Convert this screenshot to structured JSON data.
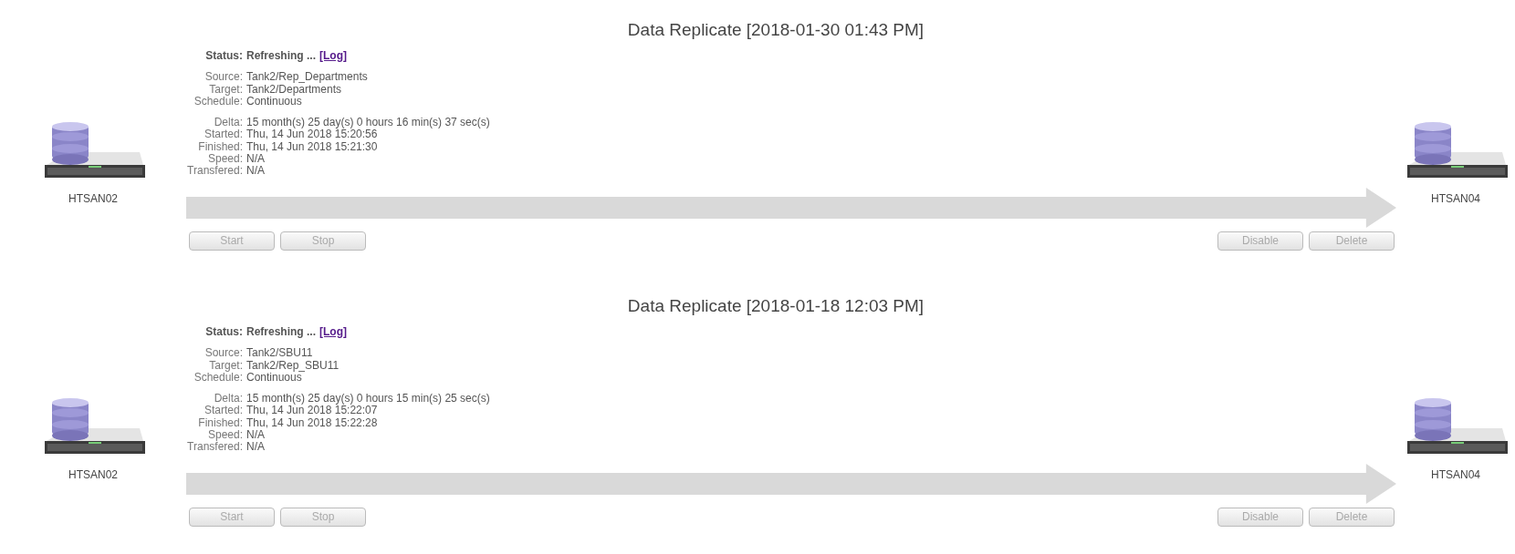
{
  "replications": [
    {
      "title": "Data Replicate [2018-01-30 01:43 PM]",
      "status": {
        "label": "Status:",
        "value": "Refreshing ...",
        "link": "[Log]"
      },
      "groups": [
        [
          {
            "label": "Source:",
            "value": "Tank2/Rep_Departments"
          },
          {
            "label": "Target:",
            "value": "Tank2/Departments"
          },
          {
            "label": "Schedule:",
            "value": "Continuous"
          }
        ],
        [
          {
            "label": "Delta:",
            "value": "15 month(s) 25 day(s) 0 hours 16 min(s) 37 sec(s)"
          },
          {
            "label": "Started:",
            "value": "Thu, 14 Jun 2018 15:20:56"
          },
          {
            "label": "Finished:",
            "value": "Thu, 14 Jun 2018 15:21:30"
          },
          {
            "label": "Speed:",
            "value": "N/A"
          },
          {
            "label": "Transfered:",
            "value": "N/A"
          }
        ]
      ],
      "source_host": "HTSAN02",
      "target_host": "HTSAN04",
      "left_buttons": [
        {
          "label": "Start",
          "disabled": true
        },
        {
          "label": "Stop",
          "disabled": true
        }
      ],
      "right_buttons": [
        {
          "label": "Disable",
          "disabled": true
        },
        {
          "label": "Delete",
          "disabled": true
        }
      ]
    },
    {
      "title": "Data Replicate [2018-01-18 12:03 PM]",
      "status": {
        "label": "Status:",
        "value": "Refreshing ...",
        "link": "[Log]"
      },
      "groups": [
        [
          {
            "label": "Source:",
            "value": "Tank2/SBU11"
          },
          {
            "label": "Target:",
            "value": "Tank2/Rep_SBU11"
          },
          {
            "label": "Schedule:",
            "value": "Continuous"
          }
        ],
        [
          {
            "label": "Delta:",
            "value": "15 month(s) 25 day(s) 0 hours 15 min(s) 25 sec(s)"
          },
          {
            "label": "Started:",
            "value": "Thu, 14 Jun 2018 15:22:07"
          },
          {
            "label": "Finished:",
            "value": "Thu, 14 Jun 2018 15:22:28"
          },
          {
            "label": "Speed:",
            "value": "N/A"
          },
          {
            "label": "Transfered:",
            "value": "N/A"
          }
        ]
      ],
      "source_host": "HTSAN02",
      "target_host": "HTSAN04",
      "left_buttons": [
        {
          "label": "Start",
          "disabled": true
        },
        {
          "label": "Stop",
          "disabled": true
        }
      ],
      "right_buttons": [
        {
          "label": "Disable",
          "disabled": true
        },
        {
          "label": "Delete",
          "disabled": true
        }
      ]
    }
  ]
}
